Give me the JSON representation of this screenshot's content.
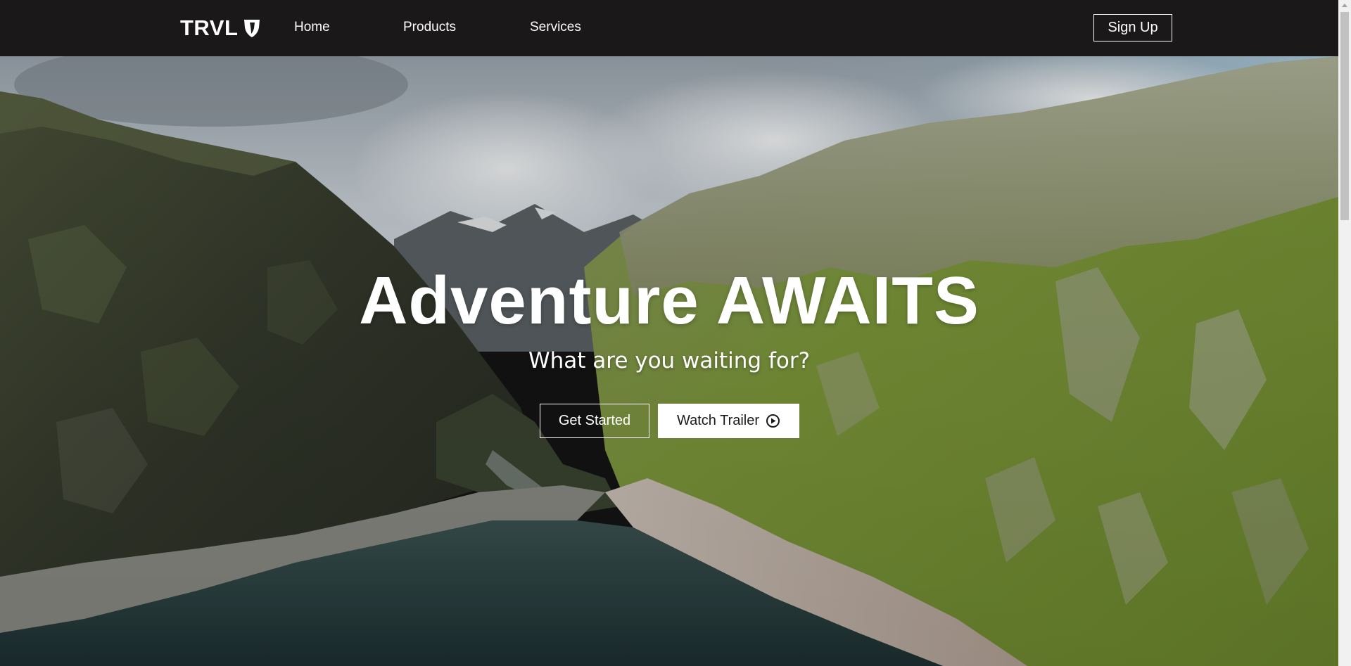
{
  "nav": {
    "logo_text": "TRVL",
    "logo_icon": "brand-shield-icon",
    "links": [
      "Home",
      "Products",
      "Services"
    ],
    "signup_label": "Sign Up"
  },
  "hero": {
    "title": "Adventure AWAITS",
    "subtitle": "What are you waiting for?",
    "get_started_label": "Get Started",
    "watch_trailer_label": "Watch Trailer",
    "watch_trailer_icon": "play-circle-icon",
    "background_description": "aerial view of a mountain valley with a lake",
    "colors": {
      "sky": "#b8c3cc",
      "mountain_left": "#3d4233",
      "mountain_right": "#7e9a3a",
      "lake": "#2a4142",
      "navbar": "#1a1818"
    }
  },
  "scrollbar": {
    "visible": true
  }
}
